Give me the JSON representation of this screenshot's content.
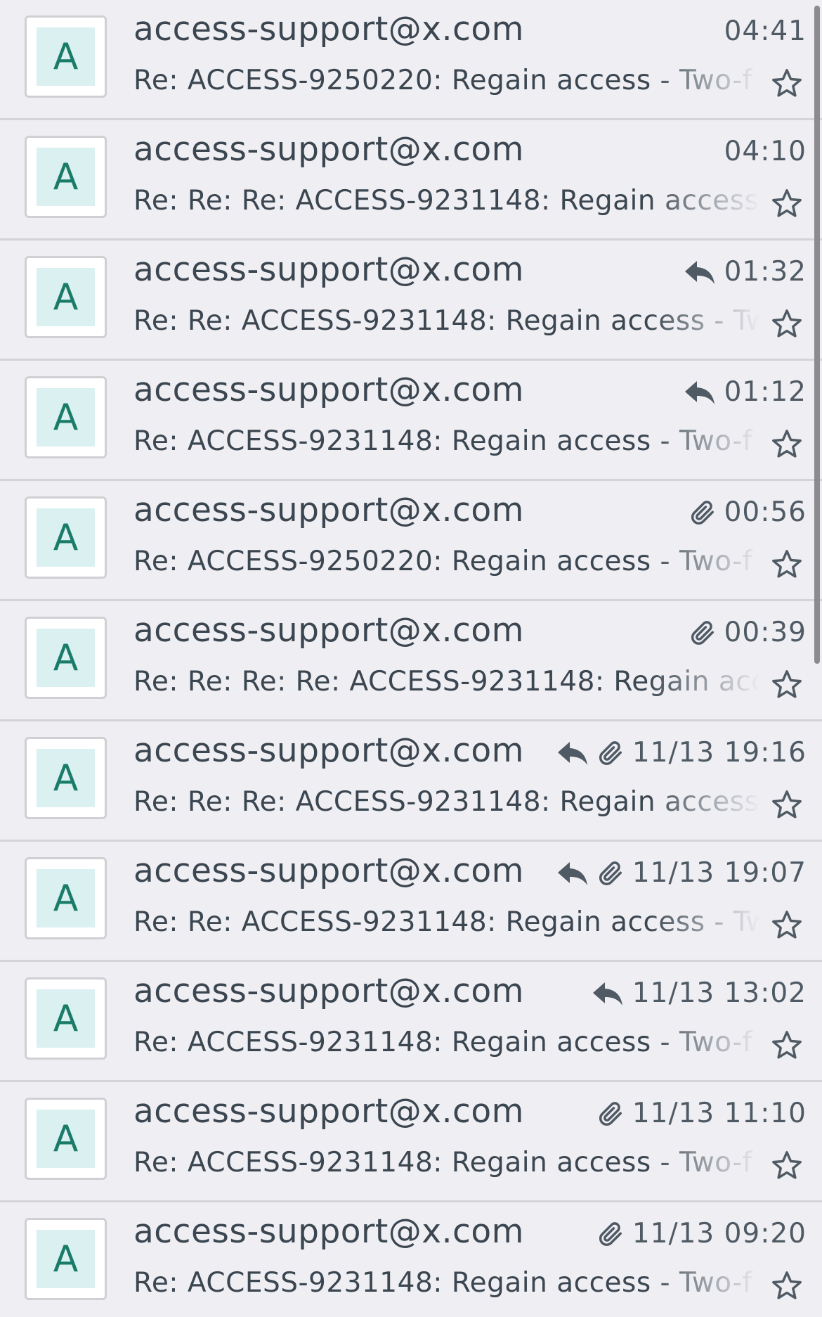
{
  "colors": {
    "background": "#efeff3",
    "text": "#3b4651",
    "avatar_bg": "#daf0f1",
    "avatar_letter": "#1a7c68",
    "divider": "#d3d3d8"
  },
  "messages": [
    {
      "avatar": "A",
      "sender": "access-support@x.com",
      "time": "04:41",
      "replied": false,
      "attachment": false,
      "subject": "Re: ACCESS-9250220: Regain access - Two-f"
    },
    {
      "avatar": "A",
      "sender": "access-support@x.com",
      "time": "04:10",
      "replied": false,
      "attachment": false,
      "subject": "Re: Re: Re: ACCESS-9231148: Regain access"
    },
    {
      "avatar": "A",
      "sender": "access-support@x.com",
      "time": "01:32",
      "replied": true,
      "attachment": false,
      "subject": "Re: Re: ACCESS-9231148: Regain access - Tw"
    },
    {
      "avatar": "A",
      "sender": "access-support@x.com",
      "time": "01:12",
      "replied": true,
      "attachment": false,
      "subject": "Re: ACCESS-9231148: Regain access - Two-f"
    },
    {
      "avatar": "A",
      "sender": "access-support@x.com",
      "time": "00:56",
      "replied": false,
      "attachment": true,
      "subject": "Re: ACCESS-9250220: Regain access - Two-f"
    },
    {
      "avatar": "A",
      "sender": "access-support@x.com",
      "time": "00:39",
      "replied": false,
      "attachment": true,
      "subject": "Re: Re: Re: Re: ACCESS-9231148: Regain acc"
    },
    {
      "avatar": "A",
      "sender": "access-support@x.com",
      "time": "11/13 19:16",
      "replied": true,
      "attachment": true,
      "subject": "Re: Re: Re: ACCESS-9231148: Regain access"
    },
    {
      "avatar": "A",
      "sender": "access-support@x.com",
      "time": "11/13 19:07",
      "replied": true,
      "attachment": true,
      "subject": "Re: Re: ACCESS-9231148: Regain access - Tw"
    },
    {
      "avatar": "A",
      "sender": "access-support@x.com",
      "time": "11/13 13:02",
      "replied": true,
      "attachment": false,
      "subject": "Re: ACCESS-9231148: Regain access - Two-f"
    },
    {
      "avatar": "A",
      "sender": "access-support@x.com",
      "time": "11/13 11:10",
      "replied": false,
      "attachment": true,
      "subject": "Re: ACCESS-9231148: Regain access - Two-f"
    },
    {
      "avatar": "A",
      "sender": "access-support@x.com",
      "time": "11/13 09:20",
      "replied": false,
      "attachment": true,
      "subject": "Re: ACCESS-9231148: Regain access - Two-f"
    }
  ],
  "icons": {
    "reply": "reply-icon",
    "attachment": "paperclip-icon",
    "star": "star-icon"
  }
}
